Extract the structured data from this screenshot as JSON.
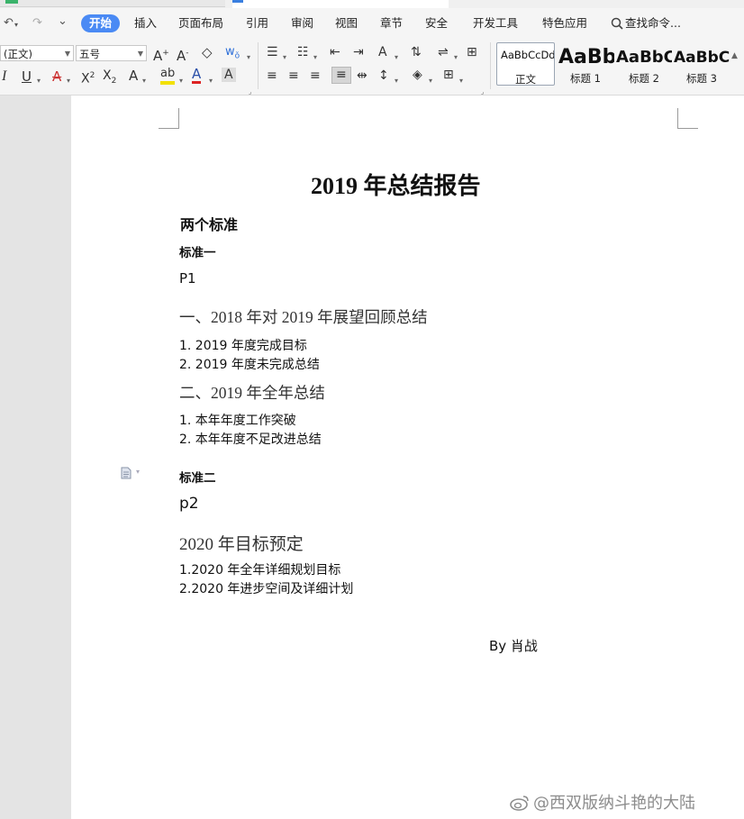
{
  "menubar": {
    "quick_access": {
      "undo_glyph": "↶",
      "redo_glyph": "↷",
      "more_glyph": "⌄"
    },
    "tabs": [
      {
        "label": "开始",
        "active": true
      },
      {
        "label": "插入"
      },
      {
        "label": "页面布局"
      },
      {
        "label": "引用"
      },
      {
        "label": "审阅"
      },
      {
        "label": "视图"
      },
      {
        "label": "章节"
      },
      {
        "label": "安全"
      },
      {
        "label": "开发工具"
      },
      {
        "label": "特色应用"
      }
    ],
    "search_placeholder": "查找命令..."
  },
  "ribbon": {
    "font_name": "(正文)",
    "font_size": "五号",
    "styles": [
      {
        "sample": "AaBbCcDd",
        "name": "正文",
        "selected": true
      },
      {
        "sample": "AaBb",
        "name": "标题 1"
      },
      {
        "sample": "AaBbC",
        "name": "标题 2"
      },
      {
        "sample": "AaBbCc",
        "name": "标题 3"
      }
    ]
  },
  "document": {
    "title": "2019 年总结报告",
    "heading": "两个标准",
    "std1": {
      "label": "标准一",
      "page_label": "P1"
    },
    "sec1": {
      "heading": "一、2018 年对 2019 年展望回顾总结",
      "items": [
        "1.  2019 年度完成目标",
        "2.  2019 年度未完成总结"
      ]
    },
    "sec2": {
      "heading": "二、2019 年全年总结",
      "items": [
        "1.  本年年度工作突破",
        "2.  本年年度不足改进总结"
      ]
    },
    "std2": {
      "label": "标准二",
      "page_label": "p2"
    },
    "sec3": {
      "heading": "2020 年目标预定",
      "items": [
        "1.2020 年全年详细规划目标",
        "2.2020 年进步空间及详细计划"
      ]
    },
    "signature": "By  肖战"
  },
  "watermark": "@西双版纳斗艳的大陆",
  "colors": {
    "accent": "#4a8af4",
    "page": "#ffffff",
    "gutter": "#e4e4e4",
    "ribbon": "#f5f5f5"
  }
}
